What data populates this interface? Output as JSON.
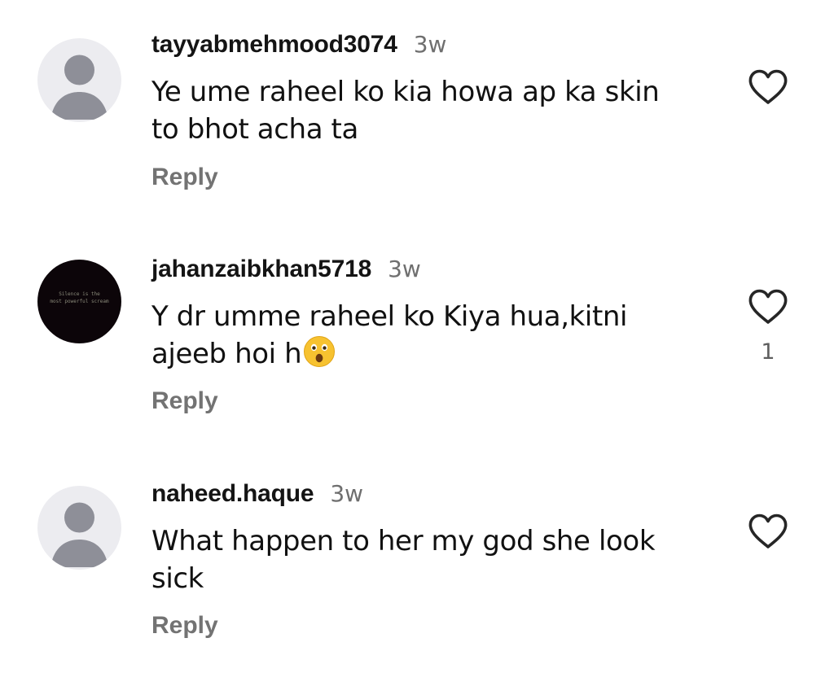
{
  "comments": [
    {
      "username": "tayyabmehmood3074",
      "time": "3w",
      "text_lines": [
        "Ye ume raheel ko kia howa ap ka skin",
        "to bhot acha ta"
      ],
      "reply_label": "Reply",
      "avatar": "default-user-icon",
      "like_count": ""
    },
    {
      "username": "jahanzaibkhan5718",
      "time": "3w",
      "text_lines": [
        "Y dr umme raheel ko Kiya hua,kitni",
        "ajeeb hoi h"
      ],
      "emoji": "astonished-face",
      "reply_label": "Reply",
      "avatar": "dark-text-avatar",
      "avatar_text": [
        "Silence is the",
        "most powerful scream"
      ],
      "like_count": "1"
    },
    {
      "username": "naheed.haque",
      "time": "3w",
      "text_lines": [
        "What happen to her my god she look",
        "sick"
      ],
      "reply_label": "Reply",
      "avatar": "default-user-icon",
      "like_count": ""
    }
  ],
  "colors": {
    "username": "#141414",
    "timestamp": "#6f6f6f",
    "reply": "#737373",
    "heart_outline": "#262626",
    "default_avatar_bg": "#ececf0",
    "default_avatar_fg": "#8e8f98"
  },
  "icons": {
    "like": "heart-outline-icon"
  }
}
